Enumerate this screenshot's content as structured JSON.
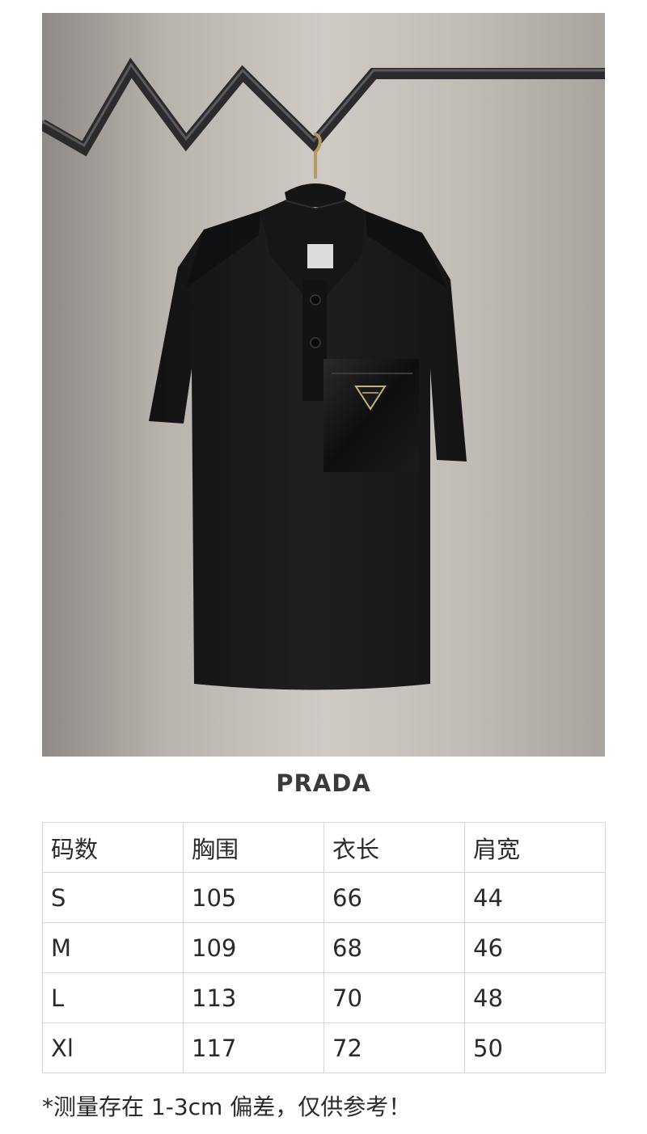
{
  "product": {
    "brand": "PRADA",
    "image": {
      "subject": "black short-sleeve polo shirt on hanger",
      "colors": {
        "background": "#bdb7b2",
        "shirt": "#1a1a1b",
        "rail": "#2b2b2d",
        "logo": "#c9b27a"
      }
    }
  },
  "size_table": {
    "headers": [
      "码数",
      "胸围",
      "衣长",
      "肩宽"
    ],
    "rows": [
      [
        "S",
        "105",
        "66",
        "44"
      ],
      [
        "M",
        "109",
        "68",
        "46"
      ],
      [
        "L",
        "113",
        "70",
        "48"
      ],
      [
        "Xl",
        "117",
        "72",
        "50"
      ]
    ]
  },
  "note": "*测量存在 1-3cm 偏差，仅供参考！"
}
